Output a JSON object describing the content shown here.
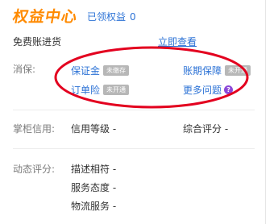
{
  "header": {
    "title": "权益中心",
    "claimed_label": "已领权益",
    "claimed_count": "0"
  },
  "promo": {
    "text": "免费账进货",
    "link": "立即查看"
  },
  "xiaobao": {
    "label": "消保:",
    "items": [
      {
        "label": "保证金",
        "tag": "未缴存"
      },
      {
        "label": "账期保障",
        "tag": "未开通"
      },
      {
        "label": "订单险",
        "tag": "未开通"
      },
      {
        "label": "更多问题",
        "tag": ""
      }
    ]
  },
  "credit": {
    "label": "掌柜信用:",
    "level_label": "信用等级 -",
    "score_label": "综合评分 -"
  },
  "dynamic": {
    "label": "动态评分:",
    "items": [
      "描述相符 -",
      "服务态度 -",
      "物流服务 -"
    ]
  },
  "colors": {
    "accent": "#ff8a00",
    "link": "#2d73d6",
    "annotation_oval": "#e3001f"
  },
  "icons": {
    "help": "question-circle-icon"
  }
}
